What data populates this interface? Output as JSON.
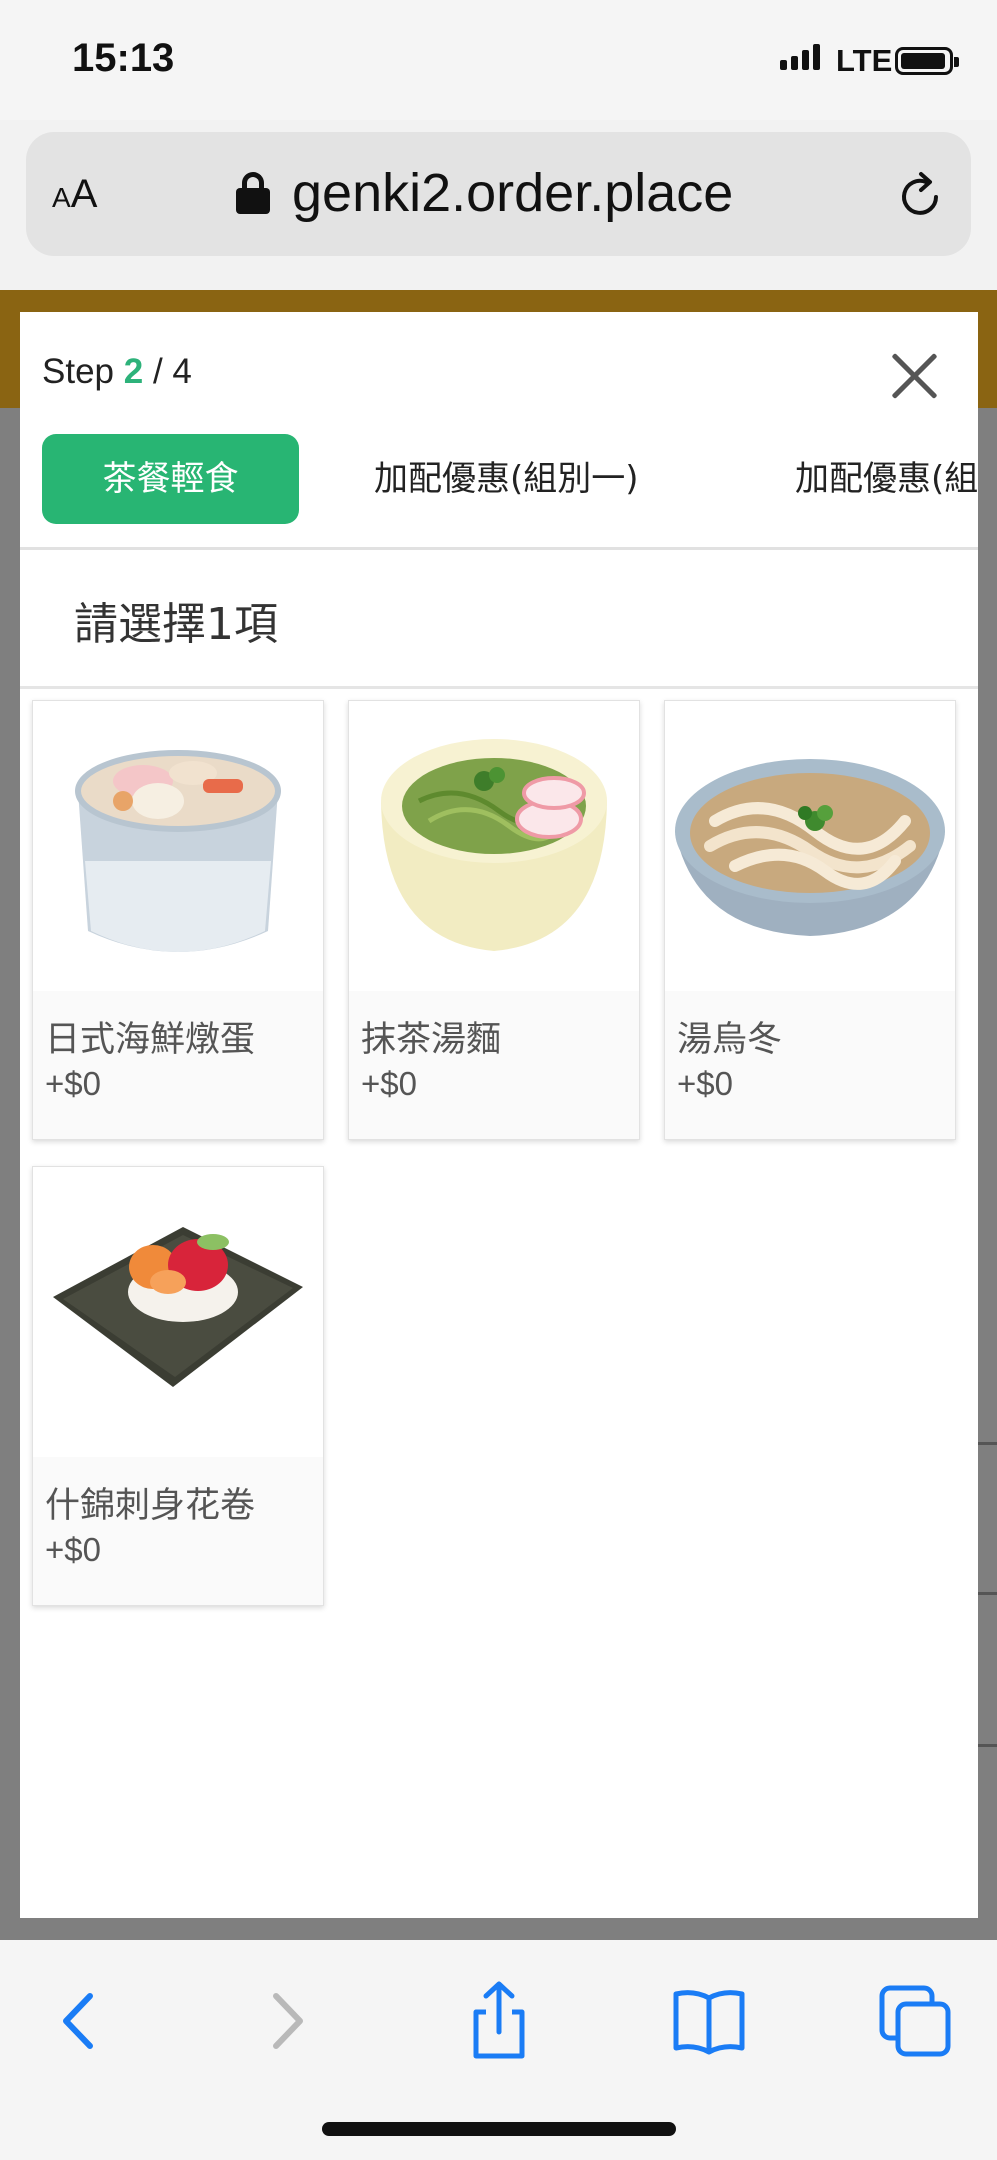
{
  "status_bar": {
    "time": "15:13",
    "network": "LTE"
  },
  "browser": {
    "aa_small": "A",
    "aa_large": "A",
    "url": "genki2.order.place"
  },
  "modal": {
    "step_prefix": "Step",
    "step_current": "2",
    "step_separator": "/",
    "step_total": "4",
    "tabs": [
      {
        "label": "茶餐輕食"
      },
      {
        "label": "加配優惠(組別一)"
      },
      {
        "label": "加配優惠(組別二)"
      }
    ],
    "prompt": "請選擇1項",
    "items": [
      {
        "name": "日式海鮮燉蛋",
        "price": "+$0"
      },
      {
        "name": "抹茶湯麵",
        "price": "+$0"
      },
      {
        "name": "湯烏冬",
        "price": "+$0"
      },
      {
        "name": "什錦刺身花卷",
        "price": "+$0"
      }
    ]
  },
  "colors": {
    "accent": "#28b573",
    "header_brown": "#8a6412",
    "ios_blue": "#1a7cf5"
  },
  "toolbar_icons": [
    "back-icon",
    "forward-icon",
    "share-icon",
    "bookmarks-icon",
    "tabs-icon"
  ]
}
